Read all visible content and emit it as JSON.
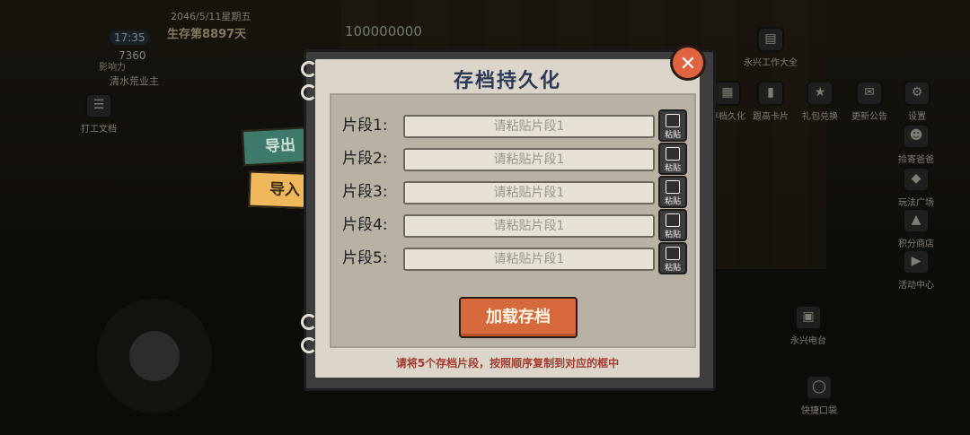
{
  "hud": {
    "date": "2046/5/11星期五",
    "survival": "生存第8897天",
    "clock": "17:35",
    "money_left": "7360",
    "money": "100000000",
    "role": "清水荒业主",
    "rank": "影响力",
    "work_label": "打工文档"
  },
  "right_icons": [
    {
      "label": "存档久化",
      "icon": "save-icon"
    },
    {
      "label": "跟高卡片",
      "icon": "card-icon"
    },
    {
      "label": "礼包兑换",
      "icon": "gift-icon"
    },
    {
      "label": "更新公告",
      "icon": "notice-icon"
    },
    {
      "label": "设置",
      "icon": "gear-icon"
    }
  ],
  "side_right": [
    {
      "label": "捡寄爸爸"
    },
    {
      "label": "玩法广场"
    },
    {
      "label": "积分商店"
    },
    {
      "label": "活动中心"
    },
    {
      "label": "永兴电台"
    },
    {
      "label": "快捷口袋"
    }
  ],
  "top_right": {
    "label": "永兴工作大全"
  },
  "tabs": {
    "export": "导出",
    "import": "导入"
  },
  "dialog": {
    "title": "存档持久化",
    "rows": [
      {
        "label": "片段1:",
        "placeholder": "请粘贴片段1",
        "paste": "粘贴"
      },
      {
        "label": "片段2:",
        "placeholder": "请粘贴片段1",
        "paste": "粘贴"
      },
      {
        "label": "片段3:",
        "placeholder": "请粘贴片段1",
        "paste": "粘贴"
      },
      {
        "label": "片段4:",
        "placeholder": "请粘贴片段1",
        "paste": "粘贴"
      },
      {
        "label": "片段5:",
        "placeholder": "请粘贴片段1",
        "paste": "粘贴"
      }
    ],
    "load_button": "加载存档",
    "hint": "请将5个存档片段，按照顺序复制到对应的框中",
    "close_glyph": "✕"
  }
}
